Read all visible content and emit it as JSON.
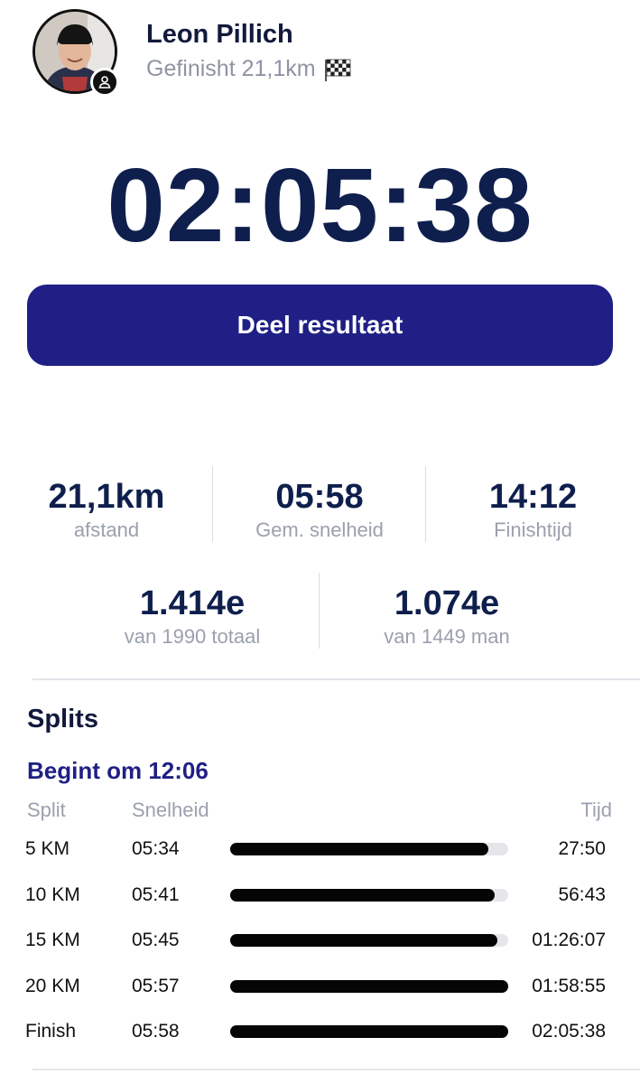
{
  "profile": {
    "name": "Leon Pillich",
    "status": "Gefinisht 21,1km",
    "status_icon": "checkered-flag-icon"
  },
  "result": {
    "time": "02:05:38",
    "share_label": "Deel resultaat"
  },
  "stats": [
    {
      "value": "21,1km",
      "label": "afstand"
    },
    {
      "value": "05:58",
      "label": "Gem. snelheid"
    },
    {
      "value": "14:12",
      "label": "Finishtijd"
    }
  ],
  "ranks": [
    {
      "value": "1.414e",
      "label": "van 1990 totaal"
    },
    {
      "value": "1.074e",
      "label": "van 1449 man"
    }
  ],
  "splits": {
    "title": "Splits",
    "start": "Begint om 12:06",
    "headers": {
      "split": "Split",
      "speed": "Snelheid",
      "time": "Tijd"
    },
    "rows": [
      {
        "split": "5 KM",
        "speed": "05:34",
        "time": "27:50",
        "fill": 0.93
      },
      {
        "split": "10 KM",
        "speed": "05:41",
        "time": "56:43",
        "fill": 0.95
      },
      {
        "split": "15 KM",
        "speed": "05:45",
        "time": "01:26:07",
        "fill": 0.96
      },
      {
        "split": "20 KM",
        "speed": "05:57",
        "time": "01:58:55",
        "fill": 1.0
      },
      {
        "split": "Finish",
        "speed": "05:58",
        "time": "02:05:38",
        "fill": 1.0
      }
    ]
  },
  "colors": {
    "accent": "#1f1f85",
    "text_dark": "#0f1f4d",
    "muted": "#9aa0ad",
    "bar": "#050505"
  }
}
